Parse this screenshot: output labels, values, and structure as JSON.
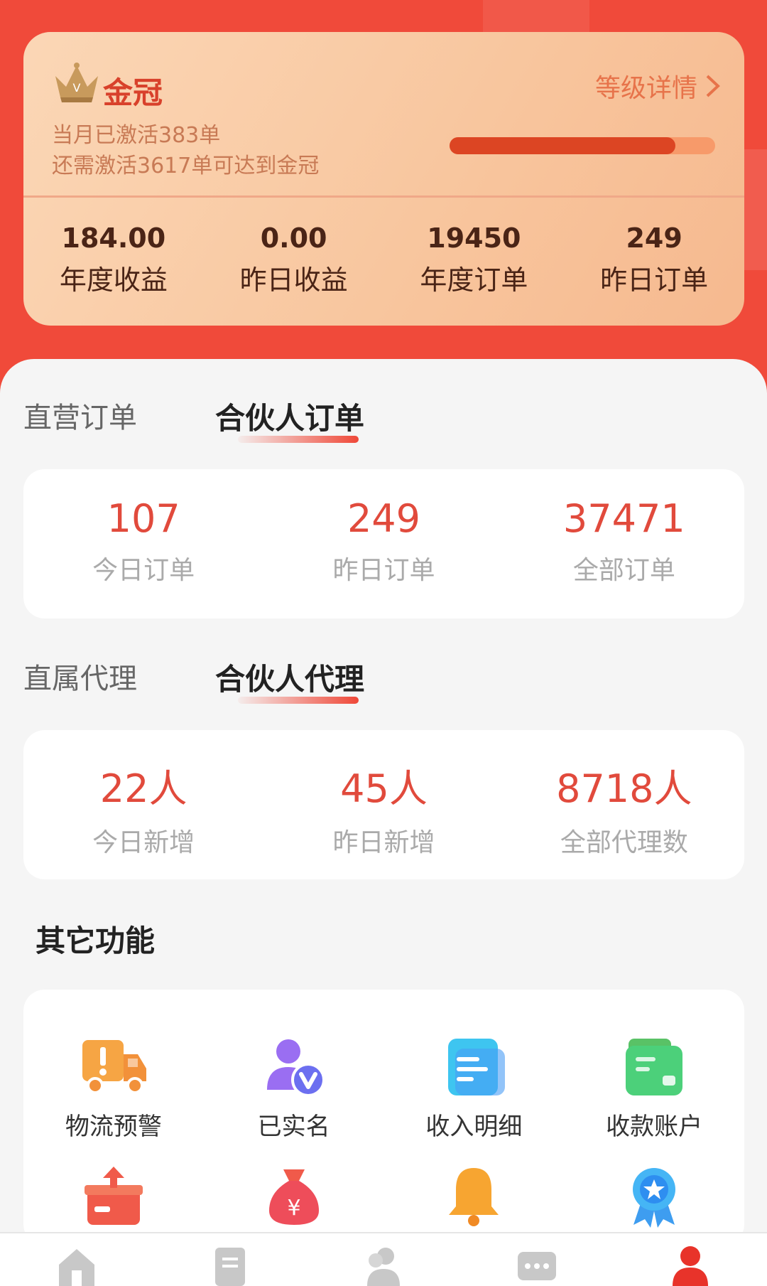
{
  "level": {
    "name": "金冠",
    "detail_label": "等级详情",
    "activated_text": "当月已激活383单",
    "need_text": "还需激活3617单可达到金冠",
    "progress_percent": 85,
    "stats": [
      {
        "value": "184.00",
        "label": "年度收益"
      },
      {
        "value": "0.00",
        "label": "昨日收益"
      },
      {
        "value": "19450",
        "label": "年度订单"
      },
      {
        "value": "249",
        "label": "昨日订单"
      }
    ]
  },
  "orders": {
    "tabs": [
      "直营订单",
      "合伙人订单"
    ],
    "active_tab": 1,
    "stats": [
      {
        "value": "107",
        "label": "今日订单"
      },
      {
        "value": "249",
        "label": "昨日订单"
      },
      {
        "value": "37471",
        "label": "全部订单"
      }
    ]
  },
  "agents": {
    "tabs": [
      "直属代理",
      "合伙人代理"
    ],
    "active_tab": 1,
    "stats": [
      {
        "value": "22人",
        "label": "今日新增"
      },
      {
        "value": "45人",
        "label": "昨日新增"
      },
      {
        "value": "8718人",
        "label": "全部代理数"
      }
    ]
  },
  "functions": {
    "title": "其它功能",
    "items": [
      {
        "label": "物流预警",
        "icon": "truck-warning-icon"
      },
      {
        "label": "已实名",
        "icon": "verified-user-icon"
      },
      {
        "label": "收入明细",
        "icon": "income-detail-icon"
      },
      {
        "label": "收款账户",
        "icon": "wallet-icon"
      }
    ],
    "row2_icons": [
      "box-upload-icon",
      "money-bag-icon",
      "bell-icon",
      "badge-star-icon"
    ]
  },
  "nav": {
    "items": [
      "home-icon",
      "orders-icon",
      "team-icon",
      "message-icon",
      "profile-icon"
    ],
    "active": 4
  },
  "colors": {
    "brand_red": "#f04a3a",
    "value_red": "#e14a3c"
  }
}
